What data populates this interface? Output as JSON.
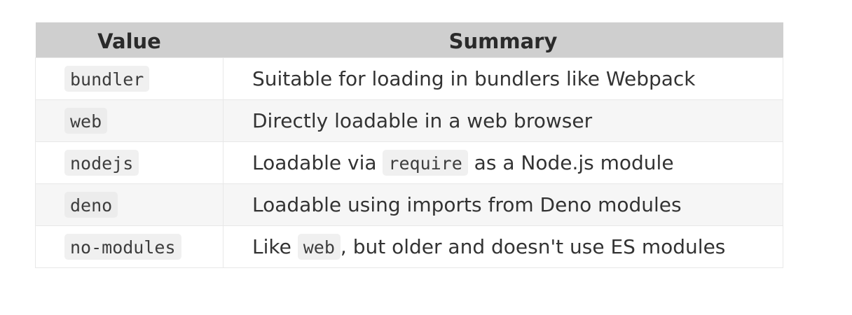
{
  "table": {
    "headers": {
      "value": "Value",
      "summary": "Summary"
    },
    "rows": [
      {
        "value": "bundler",
        "summary": {
          "before": "Suitable for loading in bundlers like Webpack",
          "code": "",
          "after": ""
        }
      },
      {
        "value": "web",
        "summary": {
          "before": "Directly loadable in a web browser",
          "code": "",
          "after": ""
        }
      },
      {
        "value": "nodejs",
        "summary": {
          "before": "Loadable via ",
          "code": "require",
          "after": " as a Node.js module"
        }
      },
      {
        "value": "deno",
        "summary": {
          "before": "Loadable using imports from Deno modules",
          "code": "",
          "after": ""
        }
      },
      {
        "value": "no-modules",
        "summary": {
          "before": "Like ",
          "code": "web",
          "after": ", but older and doesn't use ES modules"
        }
      }
    ]
  }
}
